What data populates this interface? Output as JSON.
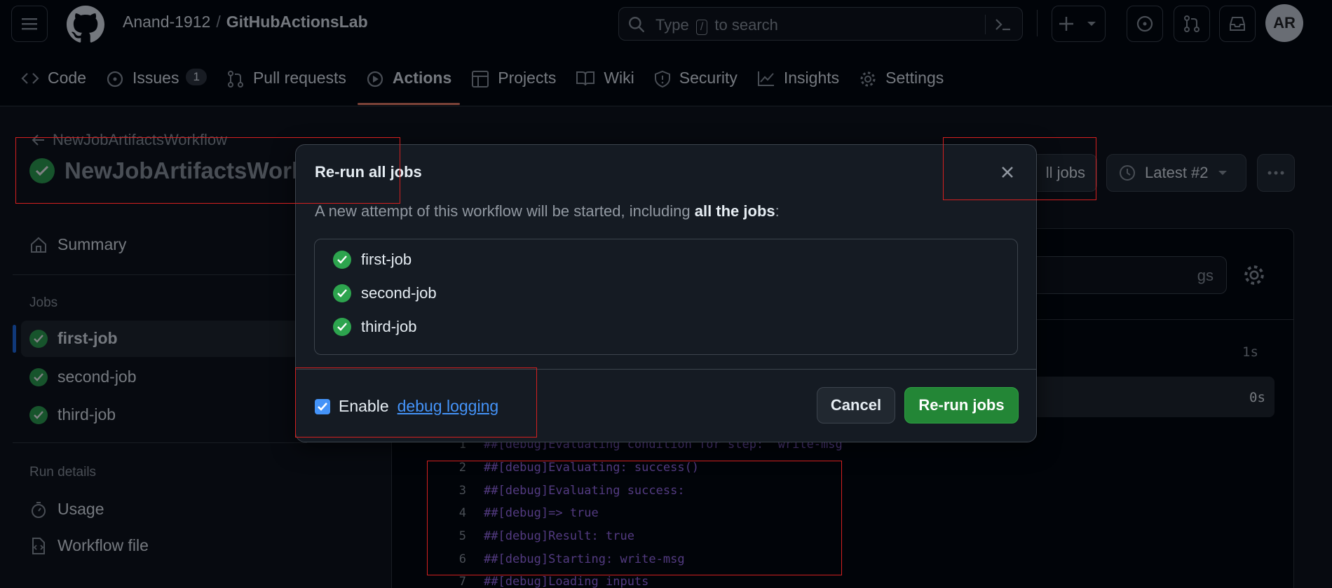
{
  "header": {
    "owner": "Anand-1912",
    "separator": "/",
    "repo": "GitHubActionsLab",
    "search_prefix": "Type",
    "search_key": "/",
    "search_suffix": "to search",
    "avatar_initials": "AR"
  },
  "tabs": [
    {
      "label": "Code",
      "icon": "code-icon"
    },
    {
      "label": "Issues",
      "icon": "issue-icon",
      "count": "1"
    },
    {
      "label": "Pull requests",
      "icon": "pull-request-icon"
    },
    {
      "label": "Actions",
      "icon": "play-icon",
      "active": true
    },
    {
      "label": "Projects",
      "icon": "table-icon"
    },
    {
      "label": "Wiki",
      "icon": "book-icon"
    },
    {
      "label": "Security",
      "icon": "shield-icon"
    },
    {
      "label": "Insights",
      "icon": "graph-icon"
    },
    {
      "label": "Settings",
      "icon": "gear-icon"
    }
  ],
  "page": {
    "back_label": "NewJobArtifactsWorkflow",
    "title": "NewJobArtifactsWork",
    "rerun_partial": "ll jobs",
    "latest": "Latest #2"
  },
  "sidebar": {
    "summary": "Summary",
    "jobs_heading": "Jobs",
    "jobs": [
      "first-job",
      "second-job",
      "third-job"
    ],
    "run_details_heading": "Run details",
    "usage": "Usage",
    "workflow_file": "Workflow file"
  },
  "panel": {
    "search_partial": "gs",
    "step1_time": "1s",
    "step2_time": "0s",
    "log_lines": [
      {
        "n": "1",
        "text": "##[debug]Evaluating condition for step: 'write-msg'"
      },
      {
        "n": "2",
        "text": "##[debug]Evaluating: success()"
      },
      {
        "n": "3",
        "text": "##[debug]Evaluating success:"
      },
      {
        "n": "4",
        "text": "##[debug]=> true"
      },
      {
        "n": "5",
        "text": "##[debug]Result: true"
      },
      {
        "n": "6",
        "text": "##[debug]Starting: write-msg"
      },
      {
        "n": "7",
        "text": "##[debug]Loading inputs"
      }
    ]
  },
  "dialog": {
    "title": "Re-run all jobs",
    "desc_prefix": "A new attempt of this workflow will be started, including",
    "desc_bold": "all the jobs",
    "desc_suffix": ":",
    "jobs": [
      "first-job",
      "second-job",
      "third-job"
    ],
    "debug_prefix": "Enable",
    "debug_link": "debug logging",
    "debug_checked": true,
    "cancel": "Cancel",
    "confirm": "Re-run jobs"
  },
  "colors": {
    "success": "#2da44e",
    "accent": "#4493f8",
    "primary_button": "#238636",
    "active_tab_underline": "#f78166",
    "annotation": "#d42020"
  }
}
